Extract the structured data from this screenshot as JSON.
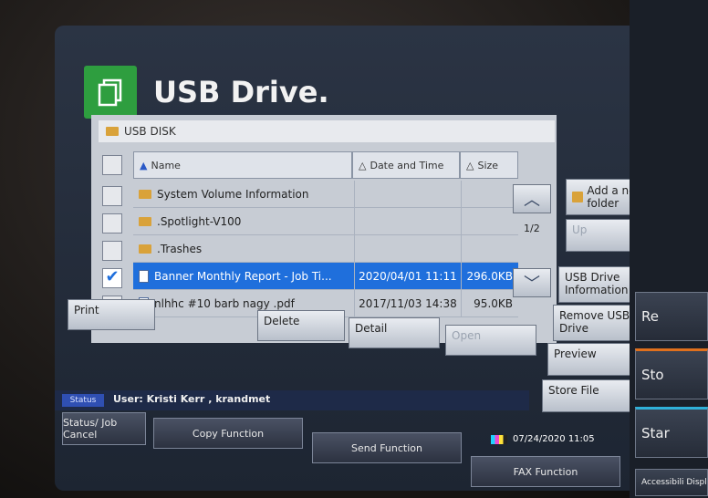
{
  "window": {
    "title": "USB Drive."
  },
  "path": {
    "label": "USB DISK"
  },
  "columns": {
    "name": "Name",
    "date": "Date and Time",
    "size": "Size"
  },
  "files": [
    {
      "name": "System Volume Information",
      "date": "",
      "size": "",
      "selected": false,
      "type": "folder"
    },
    {
      "name": ".Spotlight-V100",
      "date": "",
      "size": "",
      "selected": false,
      "type": "folder"
    },
    {
      "name": ".Trashes",
      "date": "",
      "size": "",
      "selected": false,
      "type": "folder"
    },
    {
      "name": "Banner Monthly Report - Job Ti...",
      "date": "2020/04/01 11:11",
      "size": "296.0KB",
      "selected": true,
      "type": "file"
    },
    {
      "name": "nlhhc #10 barb nagy .pdf",
      "date": "2017/11/03 14:38",
      "size": "95.0KB",
      "selected": false,
      "type": "file"
    }
  ],
  "pagination": {
    "label": "1/2"
  },
  "side_buttons": {
    "add_folder": "Add a new folder",
    "up": "Up",
    "usb_info": "USB Drive Information",
    "remove_usb": "Remove USB Drive",
    "preview": "Preview",
    "store_file": "Store File"
  },
  "bottom_buttons": {
    "print": "Print",
    "delete": "Delete",
    "detail": "Detail",
    "open": "Open"
  },
  "status": {
    "tag": "Status",
    "user": "User: Kristi Kerr , krandmet"
  },
  "functions": {
    "status_job_cancel": "Status/ Job Cancel",
    "copy": "Copy Function",
    "send": "Send Function",
    "fax": "FAX Function"
  },
  "clock": {
    "datetime": "07/24/2020 11:05"
  },
  "right_keys": {
    "reset": "Re",
    "stop": "Sto",
    "start": "Star",
    "accessibility": "Accessibili Displ"
  },
  "colors": {
    "accent": "#1f6fdc",
    "app_icon": "#2e9e3f"
  }
}
